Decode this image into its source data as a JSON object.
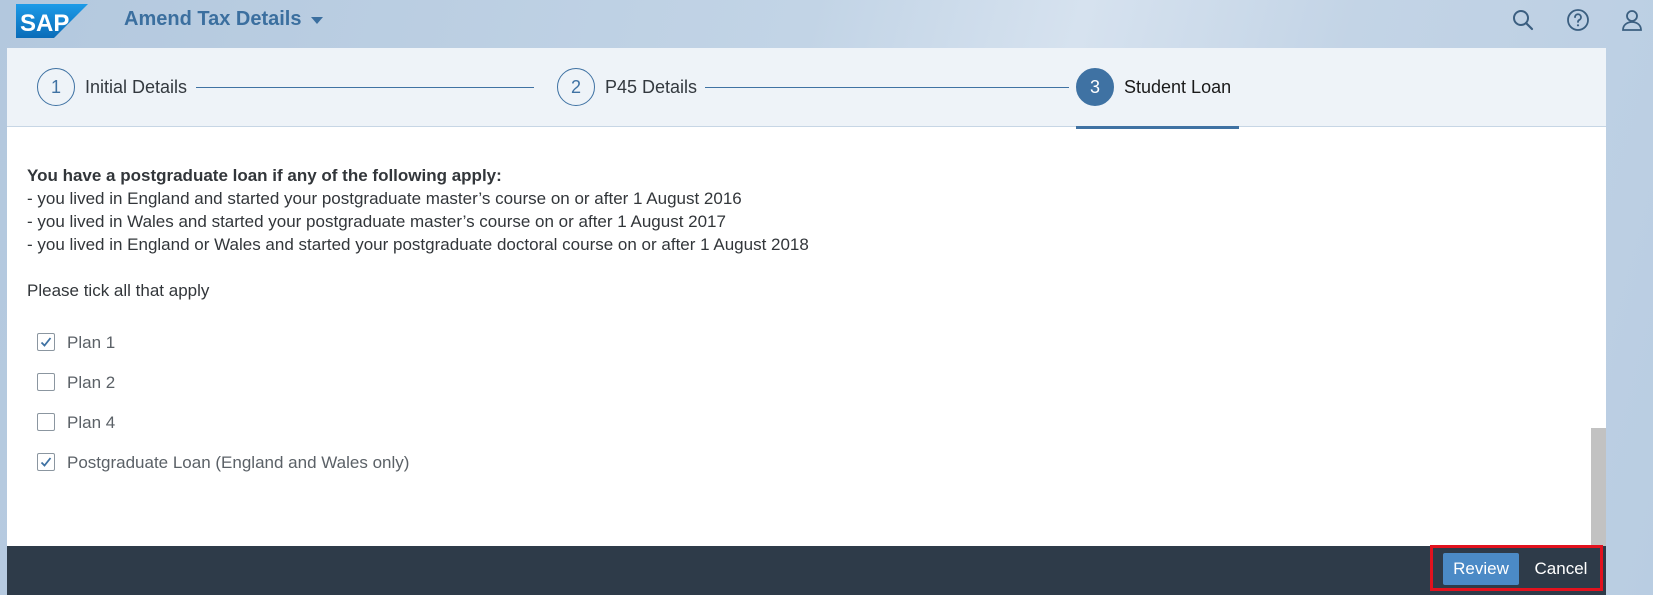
{
  "shell": {
    "logo_text": "SAP",
    "app_title": "Amend Tax Details",
    "icons": [
      "search-icon",
      "help-icon",
      "user-icon"
    ],
    "brand_color": "#1d84c9"
  },
  "wizard": {
    "steps": [
      {
        "number": "1",
        "label": "Initial Details",
        "active": false
      },
      {
        "number": "2",
        "label": "P45 Details",
        "active": false
      },
      {
        "number": "3",
        "label": "Student Loan",
        "active": true
      }
    ],
    "accent_color": "#3f72a3"
  },
  "content": {
    "heading": "You have a postgraduate loan if any of the following apply:",
    "bullets": [
      "- you lived in England and started your postgraduate master’s course on or after 1 August 2016",
      "- you lived in Wales and started your postgraduate master’s course on or after 1 August 2017",
      "- you lived in England or Wales and started your postgraduate doctoral course on or after 1 August 2018"
    ],
    "instruction": "Please tick all that apply",
    "options": [
      {
        "label": "Plan 1",
        "checked": true
      },
      {
        "label": "Plan 2",
        "checked": false
      },
      {
        "label": "Plan 4",
        "checked": false
      },
      {
        "label": "Postgraduate Loan (England and Wales only)",
        "checked": true
      }
    ]
  },
  "footer": {
    "review_label": "Review",
    "cancel_label": "Cancel",
    "highlight_color": "#e2121e"
  }
}
